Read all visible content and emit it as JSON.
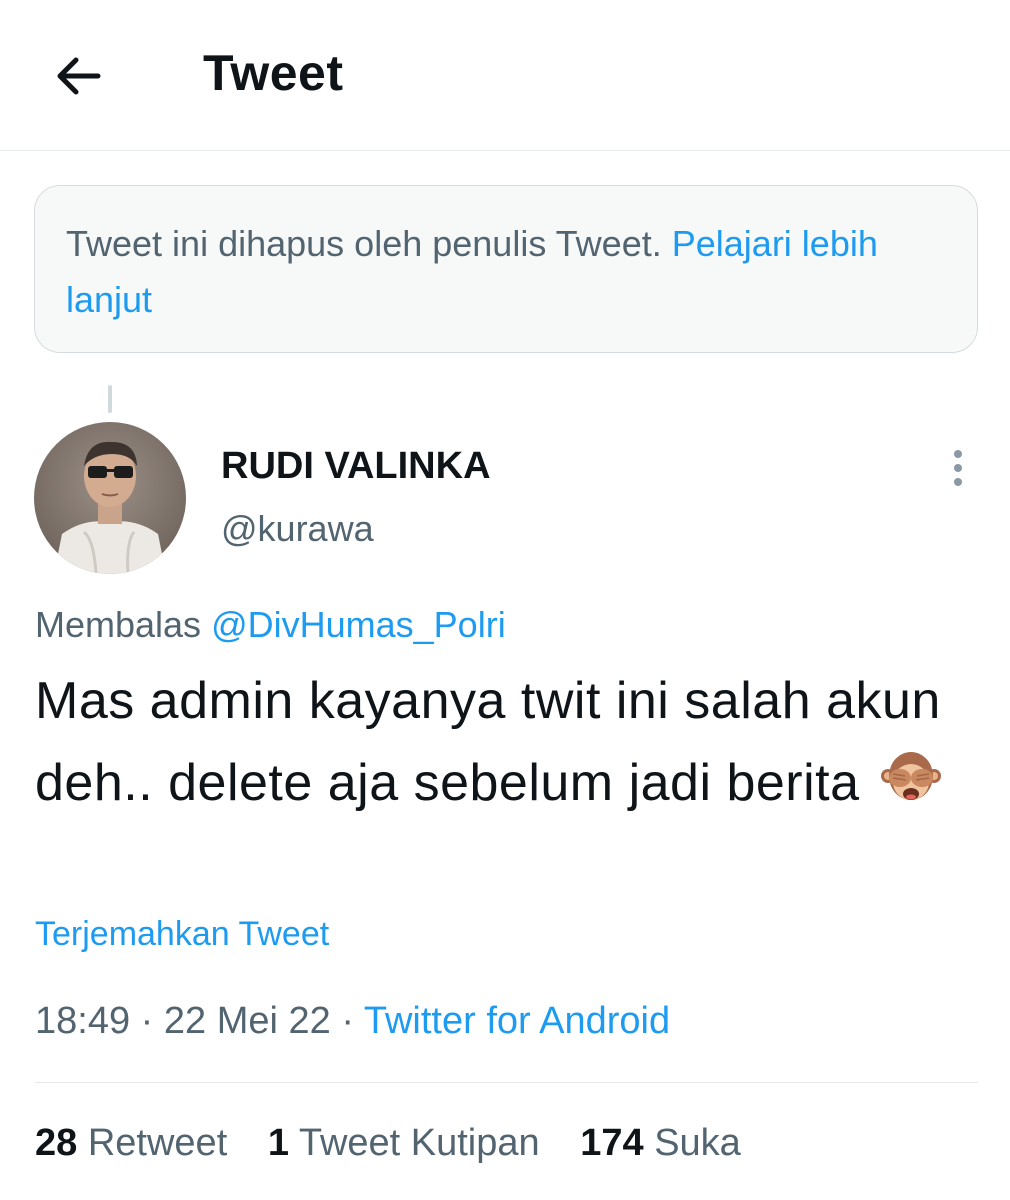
{
  "header": {
    "title": "Tweet"
  },
  "deleted_notice": {
    "text": "Tweet ini dihapus oleh penulis Tweet.",
    "link": "Pelajari lebih lanjut"
  },
  "author": {
    "name": "RUDI VALINKA",
    "handle": "@kurawa"
  },
  "tweet": {
    "reply_prefix": "Membalas",
    "reply_to": "@DivHumas_Polri",
    "text": "Mas admin kayanya twit ini salah akun deh.. delete aja sebelum jadi berita",
    "emoji": "see-no-evil-monkey-icon",
    "translate": "Terjemahkan Tweet"
  },
  "meta": {
    "time": "18:49",
    "separator": "·",
    "date": "22 Mei 22",
    "source": "Twitter for Android"
  },
  "stats": {
    "retweets": {
      "count": "28",
      "label": "Retweet"
    },
    "quotes": {
      "count": "1",
      "label": "Tweet Kutipan"
    },
    "likes": {
      "count": "174",
      "label": "Suka"
    }
  },
  "colors": {
    "accent": "#1d9bf0",
    "secondary_text": "#536471",
    "primary_text": "#0f1419"
  }
}
